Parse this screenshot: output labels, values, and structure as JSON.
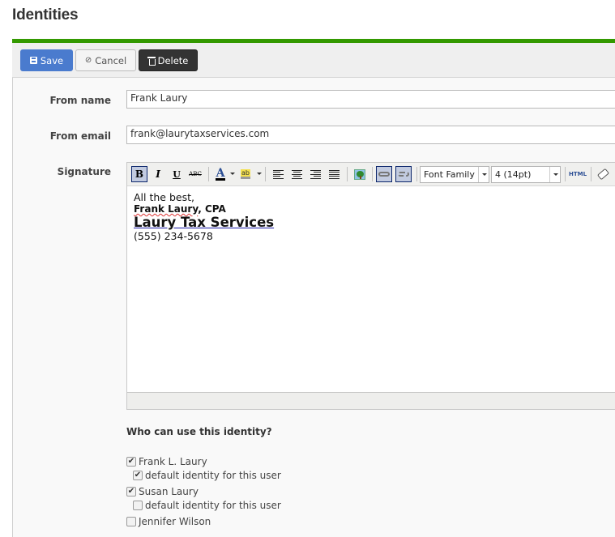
{
  "page": {
    "title": "Identities"
  },
  "colors": {
    "accent_bar": "#339900",
    "save": "#4a7bce",
    "delete": "#333333"
  },
  "toolbar": {
    "save_label": "Save",
    "cancel_label": "Cancel",
    "delete_label": "Delete",
    "save_icon": "floppy-icon",
    "cancel_icon": "ban-icon",
    "delete_icon": "trash-icon"
  },
  "form": {
    "from_name": {
      "label": "From name",
      "value": "Frank Laury"
    },
    "from_email": {
      "label": "From email",
      "value": "frank@laurytaxservices.com"
    },
    "signature": {
      "label": "Signature",
      "editor_toolbar": {
        "bold": "B",
        "italic": "I",
        "underline": "U",
        "strikethrough": "ABC",
        "font_color": "A",
        "highlight": "ab",
        "font_family": "Font Family",
        "font_size": "4 (14pt)",
        "html": "HTML",
        "bold_active": true,
        "link_active": true,
        "unlink_active": true
      },
      "content": {
        "line1": "All the best,",
        "line2_name": "Frank Laury",
        "line2_suffix": ", CPA",
        "line3": "Laury Tax Services",
        "line4": "(555) 234-5678"
      }
    }
  },
  "who": {
    "title": "Who can use this identity?",
    "users": [
      {
        "name": "Frank L. Laury",
        "checked": "✔",
        "default_label": "default identity for this user",
        "default_checked": "✔"
      },
      {
        "name": "Susan Laury",
        "checked": "✔",
        "default_label": "default identity for this user",
        "default_checked": ""
      },
      {
        "name": "Jennifer Wilson",
        "checked": ""
      }
    ]
  }
}
